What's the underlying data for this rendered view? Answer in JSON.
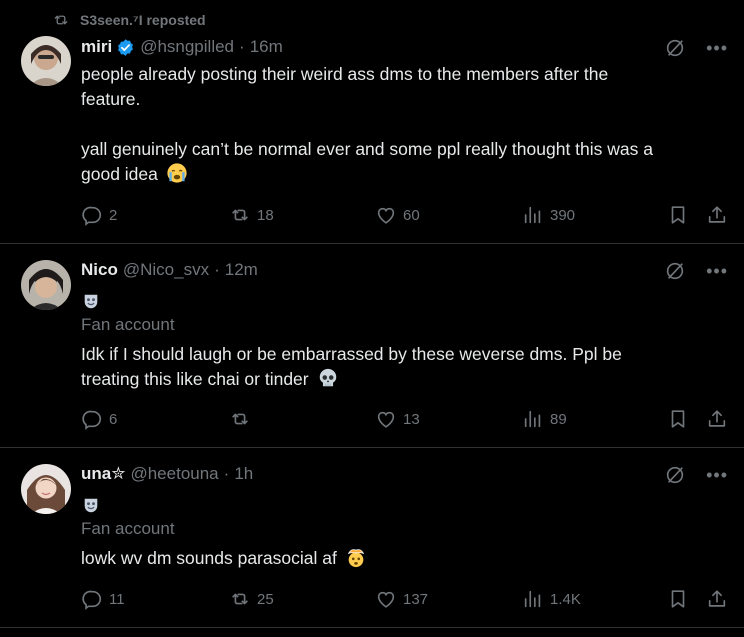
{
  "repost": {
    "text": "S3seen.⁷I reposted",
    "icon": "repost-icon"
  },
  "posts": [
    {
      "name": "miri",
      "handle": "@hsngpilled",
      "dot": "·",
      "time": "16m",
      "verified": true,
      "text_lines": [
        "people already posting their weird ass dms to the members after the",
        "feature.",
        "yall genuinely can’t be normal ever and some ppl really thought this was a",
        "good idea"
      ],
      "emoji": "crying-face-emoji",
      "stats": {
        "replies": "2",
        "reposts": "18",
        "likes": "60",
        "views": "390"
      }
    },
    {
      "name": "Nico",
      "handle": "@Nico_svx",
      "dot": "·",
      "time": "12m",
      "label": "Fan account",
      "text_lines": [
        "Idk if I should laugh or be embarrassed by these weverse dms. Ppl be",
        "treating this like chai or tinder"
      ],
      "emoji": "skull-emoji",
      "stats": {
        "replies": "6",
        "reposts": "",
        "likes": "13",
        "views": "89"
      }
    },
    {
      "name": "una✮",
      "handle": "@heetouna",
      "dot": "·",
      "time": "1h",
      "label": "Fan account",
      "text_lines": [
        "lowk wv dm sounds parasocial af"
      ],
      "emoji": "exploding-head-emoji",
      "stats": {
        "replies": "11",
        "reposts": "25",
        "likes": "137",
        "views": "1.4K"
      }
    }
  ],
  "colors": {
    "background": "#000000",
    "text": "#e7e9ea",
    "muted": "#71767b",
    "border": "#2f3336",
    "verified": "#1d9bf0"
  }
}
